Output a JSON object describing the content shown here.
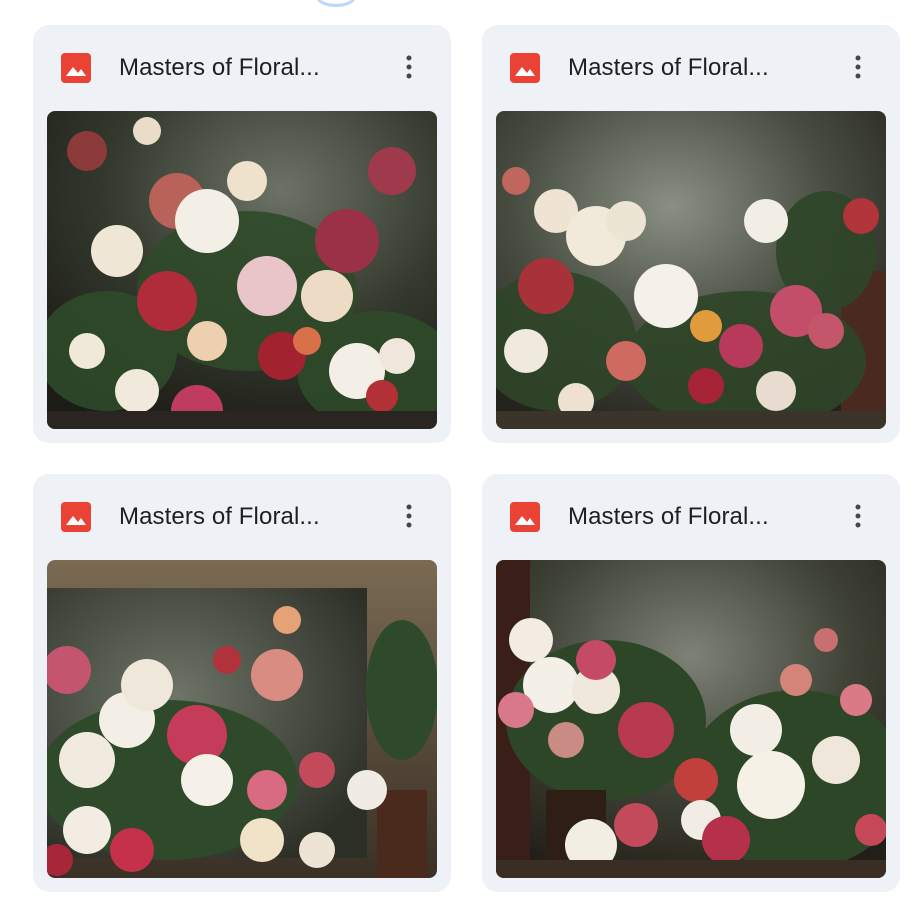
{
  "files": [
    {
      "title": "Masters of Floral...",
      "icon": "image-file-icon",
      "menu_icon": "more-vert-icon",
      "thumbnail": "floral-painting-1"
    },
    {
      "title": "Masters of Floral...",
      "icon": "image-file-icon",
      "menu_icon": "more-vert-icon",
      "thumbnail": "floral-painting-2"
    },
    {
      "title": "Masters of Floral...",
      "icon": "image-file-icon",
      "menu_icon": "more-vert-icon",
      "thumbnail": "floral-painting-3"
    },
    {
      "title": "Masters of Floral...",
      "icon": "image-file-icon",
      "menu_icon": "more-vert-icon",
      "thumbnail": "floral-painting-4"
    }
  ],
  "colors": {
    "card_bg": "#eef1f6",
    "icon_red": "#ea4335",
    "title_text": "#1f1f1f"
  }
}
